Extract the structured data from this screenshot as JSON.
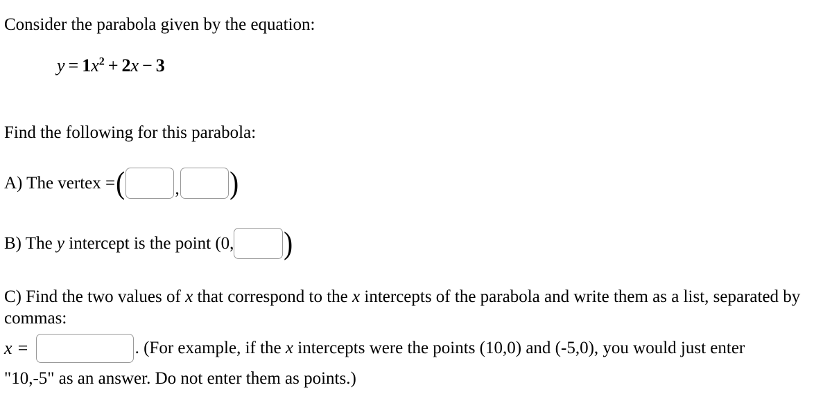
{
  "problem": {
    "prompt": "Consider the parabola given by the equation:",
    "equation": {
      "lhs": "y",
      "equals": "=",
      "coef_a": "1",
      "var_x": "x",
      "exponent": "2",
      "plus": "+",
      "coef_b": "2",
      "var_x2": "x",
      "minus": "−",
      "constant": "3",
      "plain_text": "y = 1x² + 2x − 3"
    },
    "instruction": "Find the following for this parabola:"
  },
  "part_a": {
    "label": "A) The vertex =",
    "open_paren": "(",
    "comma": ",",
    "close_paren": ")",
    "vertex_x_value": "",
    "vertex_x_placeholder": "",
    "vertex_y_value": "",
    "vertex_y_placeholder": ""
  },
  "part_b": {
    "label_before": "B) The",
    "variable": "y",
    "label_after": "intercept is the point (0,",
    "close_paren": ")",
    "y_intercept_value": "",
    "y_intercept_placeholder": ""
  },
  "part_c": {
    "text_part1": "C) Find the two values of",
    "var1": "x",
    "text_part2": "that correspond to the",
    "var2": "x",
    "text_part3": "intercepts of the parabola and write them as a list, separated by commas:",
    "x_label": "x =",
    "x_list_value": "",
    "x_list_placeholder": "",
    "example_part1": ". (For example, if the",
    "example_var": "x",
    "example_part2": "intercepts were the points (10,0) and (-5,0), you would just enter",
    "example_last_line": "\"10,-5\" as an answer. Do not enter them as points.)"
  },
  "colors": {
    "text": "#000000",
    "background": "#ffffff",
    "input_border": "#999999",
    "input_background": "#ffffff"
  }
}
